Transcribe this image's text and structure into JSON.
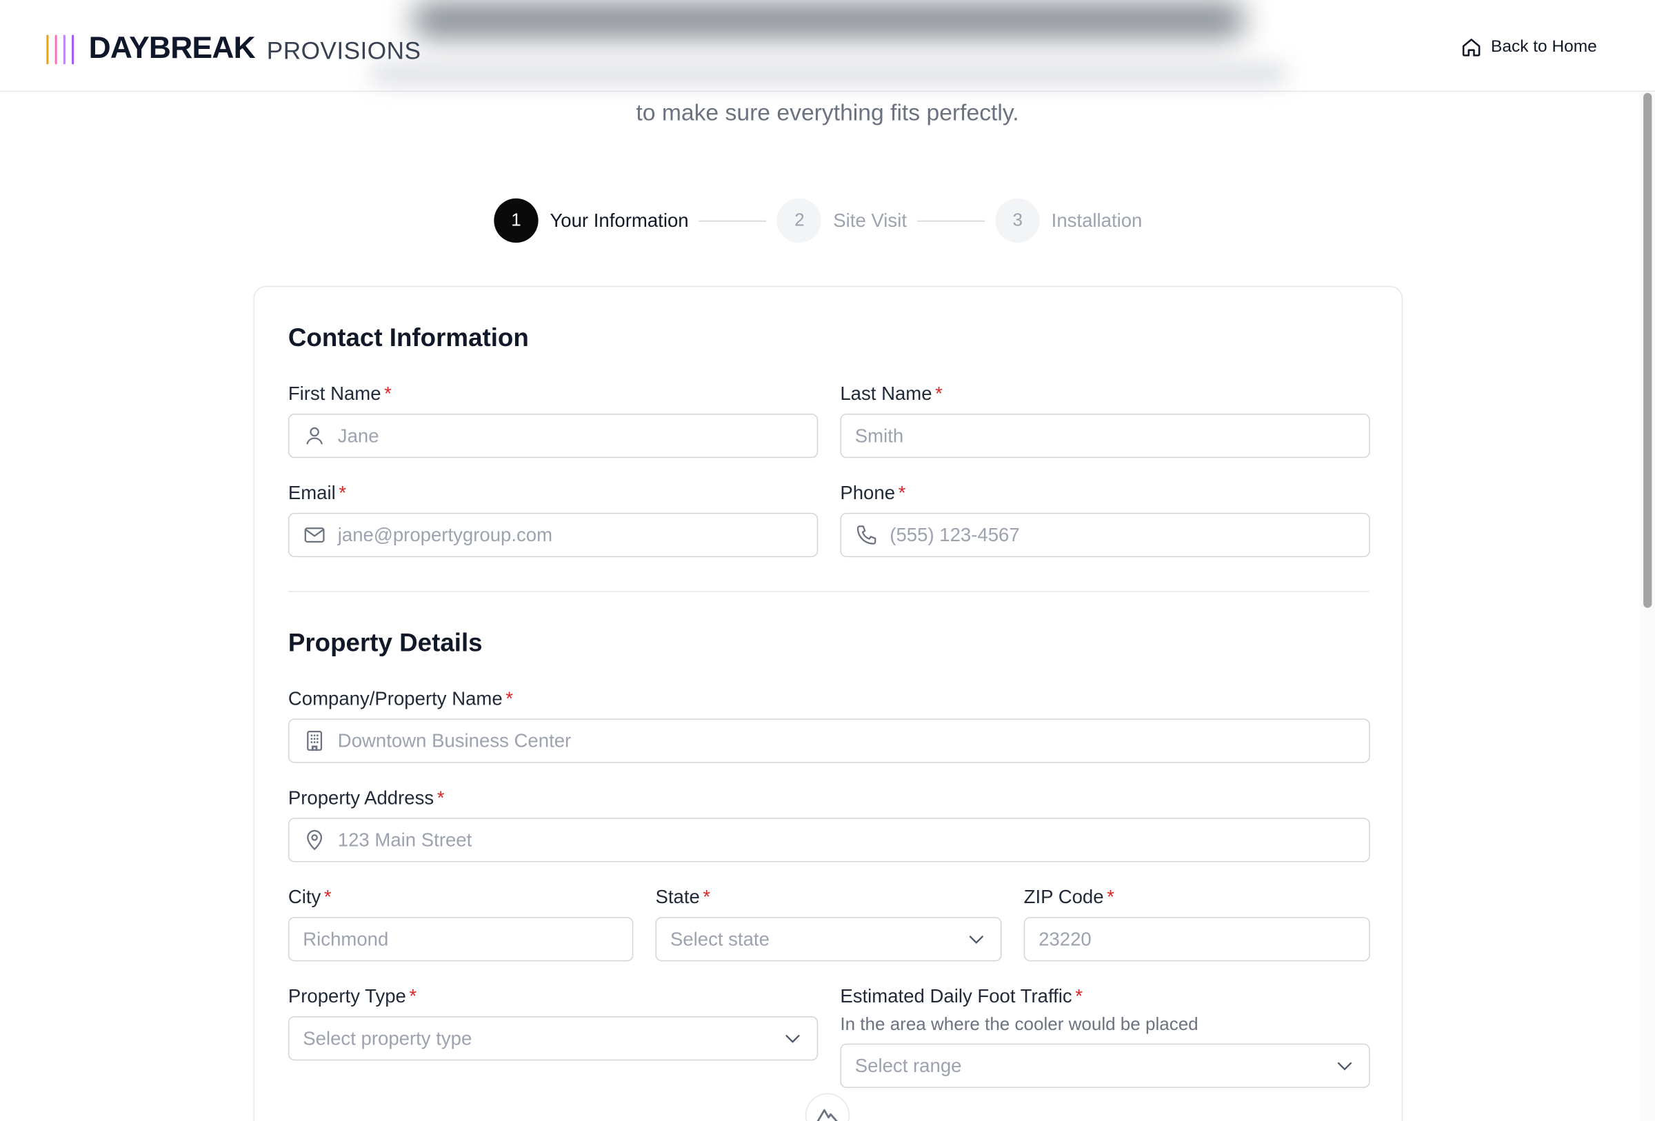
{
  "brand": {
    "name": "DAYBREAK",
    "sub": "PROVISIONS",
    "bar_colors": [
      "#f59e0b",
      "#f472b6",
      "#c084fc",
      "#a855f7"
    ]
  },
  "header": {
    "back_label": "Back to Home",
    "back_icon": "home-icon"
  },
  "hero": {
    "subtitle": "to make sure everything fits perfectly."
  },
  "stepper": {
    "steps": [
      {
        "number": "1",
        "label": "Your Information",
        "state": "active"
      },
      {
        "number": "2",
        "label": "Site Visit",
        "state": "inactive"
      },
      {
        "number": "3",
        "label": "Installation",
        "state": "inactive"
      }
    ]
  },
  "contact": {
    "title": "Contact Information",
    "first_name": {
      "label": "First Name",
      "placeholder": "Jane",
      "icon": "user-icon"
    },
    "last_name": {
      "label": "Last Name",
      "placeholder": "Smith"
    },
    "email": {
      "label": "Email",
      "placeholder": "jane@propertygroup.com",
      "icon": "mail-icon"
    },
    "phone": {
      "label": "Phone",
      "placeholder": "(555) 123-4567",
      "icon": "phone-icon"
    }
  },
  "property": {
    "title": "Property Details",
    "company": {
      "label": "Company/Property Name",
      "placeholder": "Downtown Business Center",
      "icon": "building-icon"
    },
    "address": {
      "label": "Property Address",
      "placeholder": "123 Main Street",
      "icon": "map-pin-icon"
    },
    "city": {
      "label": "City",
      "placeholder": "Richmond"
    },
    "state": {
      "label": "State",
      "placeholder": "Select state"
    },
    "zip": {
      "label": "ZIP Code",
      "placeholder": "23220"
    },
    "property_type": {
      "label": "Property Type",
      "placeholder": "Select property type"
    },
    "foot_traffic": {
      "label": "Estimated Daily Foot Traffic",
      "hint": "In the area where the cooler would be placed",
      "placeholder": "Select range"
    }
  },
  "required_marker": "*",
  "colors": {
    "accent": "#0a0a0a",
    "required": "#dc2626",
    "border": "#d1d5db"
  }
}
